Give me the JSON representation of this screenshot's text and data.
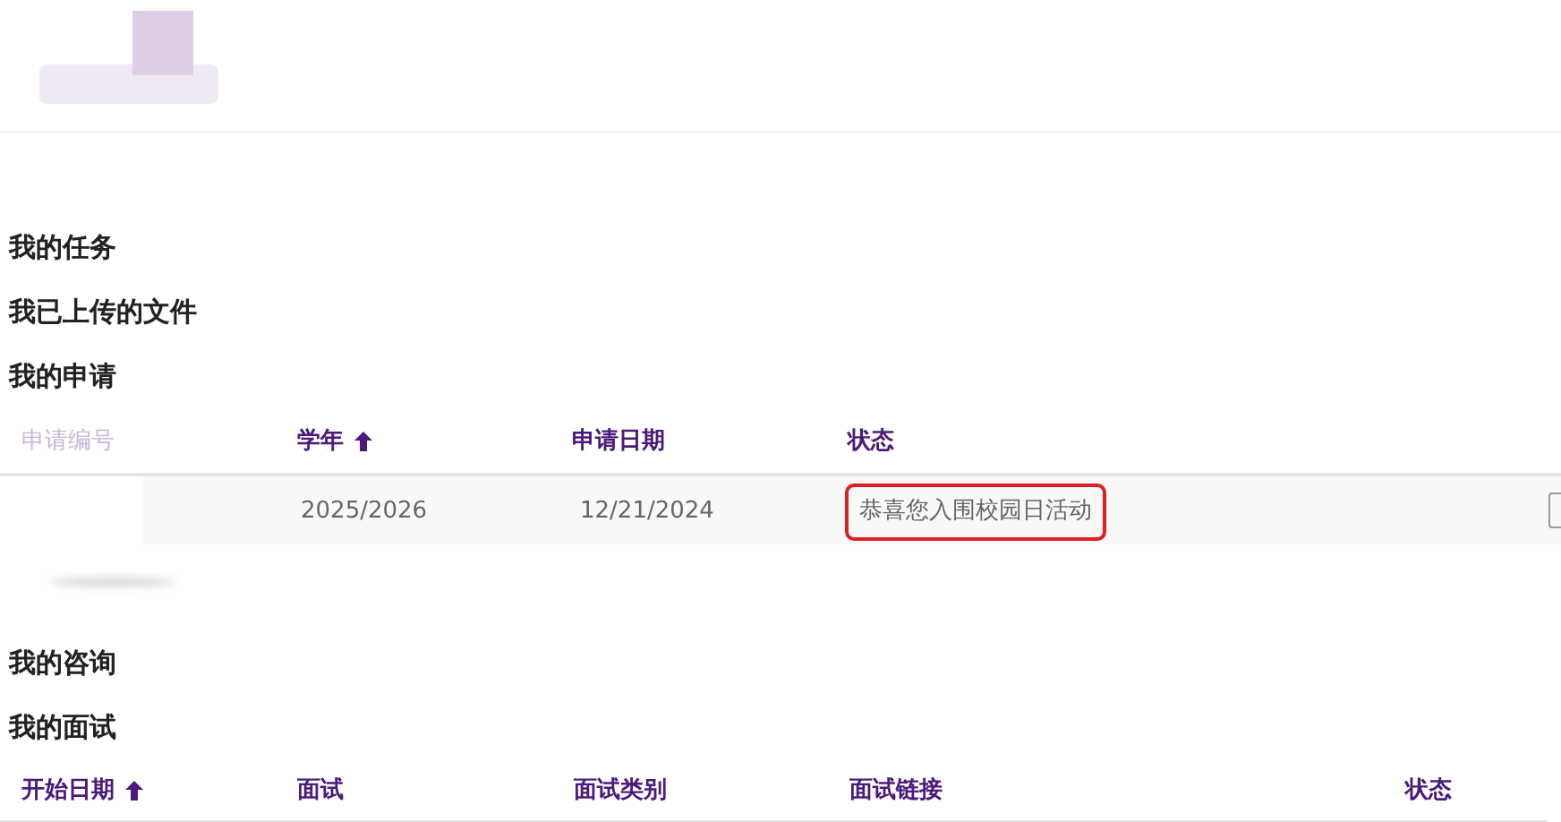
{
  "sections": [
    {
      "title": "我的任务"
    },
    {
      "title": "我已上传的文件"
    },
    {
      "title": "我的申请"
    }
  ],
  "applications": {
    "columns": [
      {
        "label": "申请编号",
        "sorted": false,
        "faded": true
      },
      {
        "label": "学年",
        "sorted": true,
        "faded": false
      },
      {
        "label": "申请日期",
        "sorted": false,
        "faded": false
      },
      {
        "label": "状态",
        "sorted": false,
        "faded": false
      }
    ],
    "rows": [
      {
        "cells": [
          "",
          "2025/2026",
          "12/21/2024",
          "恭喜您入围校园日活动"
        ],
        "highlighted": true
      }
    ]
  },
  "sections_after": [
    {
      "title": "我的咨询"
    },
    {
      "title": "我的面试"
    }
  ],
  "interviews": {
    "columns": [
      {
        "label": "开始日期",
        "sorted": true
      },
      {
        "label": "面试",
        "sorted": false
      },
      {
        "label": "面试类别",
        "sorted": false
      },
      {
        "label": "面试链接",
        "sorted": false
      },
      {
        "label": "状态",
        "sorted": false
      }
    ]
  }
}
